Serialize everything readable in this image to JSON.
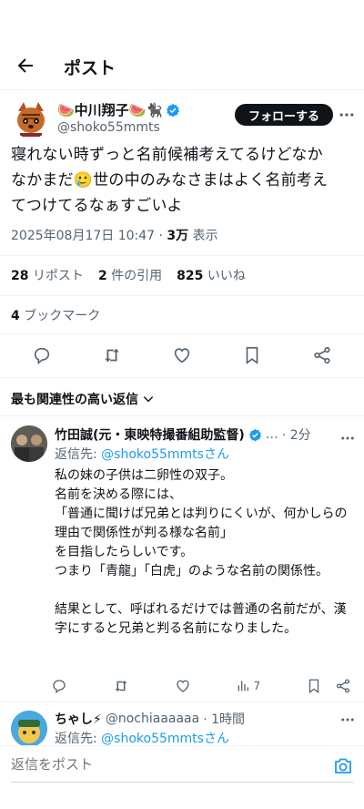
{
  "header": {
    "title": "ポスト"
  },
  "tweet": {
    "author_name": "🍉中川翔子🍉🐈‍⬛",
    "handle": "@shoko55mmts",
    "follow_label": "フォローする",
    "text_lines": [
      "寝れない時ずっと名前候補考えてるけどなか",
      "なかまだ🥲世の中のみなさまはよく名前考え",
      "てつけてるなぁすごいよ"
    ],
    "datetime": "2025年08月17日 10:47",
    "views_count": "3万",
    "views_label": "表示",
    "reposts_count": "28",
    "reposts_label": "リポスト",
    "quotes_count": "2",
    "quotes_label": "件の引用",
    "likes_count": "825",
    "likes_label": "いいね",
    "bookmarks_count": "4",
    "bookmarks_label": "ブックマーク"
  },
  "sort": {
    "label": "最も関連性の高い返信"
  },
  "reply1": {
    "name": "竹田誠(元・東映特撮番組助監督)",
    "ellipsis": "…",
    "time": "· 2分",
    "reply_to_prefix": "返信先: ",
    "reply_to_handle": "@shoko55mmtsさん",
    "text": "私の妹の子供は二卵性の双子。\n名前を決める際には、\n「普通に聞けば兄弟とは判りにくいが、何かしらの理由で関係性が判る様な名前」\nを目指したらしいです。\nつまり「青龍」「白虎」のような名前の関係性。\n\n結果として、呼ばれるだけでは普通の名前だが、漢字にすると兄弟と判る名前になりました。",
    "views": "7"
  },
  "reply2": {
    "name": "ちゃし⚡",
    "handle": "@nochiaaaaaa",
    "time": "· 1時間",
    "reply_to_prefix": "返信先: ",
    "reply_to_handle": "@shoko55mmtsさん"
  },
  "composer": {
    "placeholder": "返信をポスト"
  },
  "colors": {
    "accent": "#1d9bf0",
    "text": "#0f1419",
    "muted": "#536471"
  }
}
